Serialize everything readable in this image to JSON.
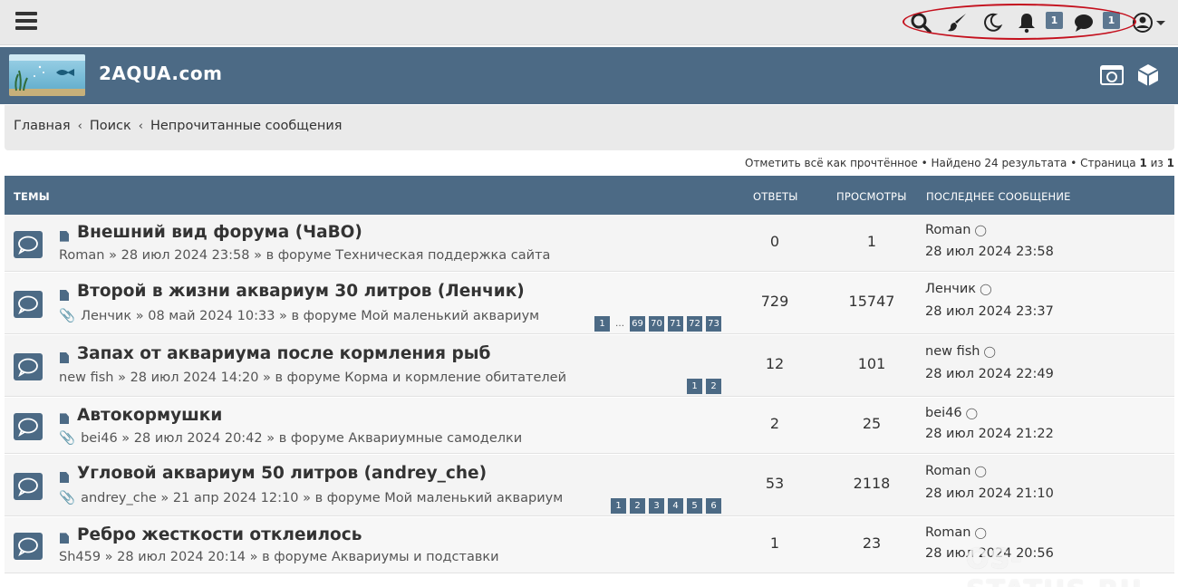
{
  "site": {
    "title": "2AQUA.com"
  },
  "topbar": {
    "notifications_count": "1",
    "messages_count": "1"
  },
  "breadcrumb": {
    "items": [
      "Главная",
      "Поиск",
      "Непрочитанные сообщения"
    ],
    "separator": "‹"
  },
  "actionbar": {
    "mark_read": "Отметить всё как прочтённое",
    "found": "Найдено 24 результата",
    "page_label": "Страница",
    "page_current": "1",
    "of": "из",
    "page_total": "1",
    "bullet": "•"
  },
  "table": {
    "headers": {
      "topics": "Темы",
      "replies": "Ответы",
      "views": "Просмотры",
      "last_post": "Последнее сообщение"
    },
    "rows": [
      {
        "title": "Внешний вид форума (ЧаВО)",
        "author": "Roman",
        "date": "28 июл 2024 23:58",
        "forum_prefix": "в форуме",
        "forum": "Техническая поддержка сайта",
        "replies": "0",
        "views": "1",
        "last_author": "Roman",
        "last_date": "28 июл 2024 23:58",
        "attachment": false,
        "pages": []
      },
      {
        "title": "Второй в жизни аквариум 30 литров (Ленчик)",
        "author": "Ленчик",
        "date": "08 май 2024 10:33",
        "forum_prefix": "в форуме",
        "forum": "Мой маленький аквариум",
        "replies": "729",
        "views": "15747",
        "last_author": "Ленчик",
        "last_date": "28 июл 2024 23:37",
        "attachment": true,
        "pages": [
          "1",
          "…",
          "69",
          "70",
          "71",
          "72",
          "73"
        ]
      },
      {
        "title": "Запах от аквариума после кормления рыб",
        "author": "new fish",
        "date": "28 июл 2024 14:20",
        "forum_prefix": "в форуме",
        "forum": "Корма и кормление обитателей",
        "replies": "12",
        "views": "101",
        "last_author": "new fish",
        "last_date": "28 июл 2024 22:49",
        "attachment": false,
        "pages": [
          "1",
          "2"
        ]
      },
      {
        "title": "Автокормушки",
        "author": "bei46",
        "date": "28 июл 2024 20:42",
        "forum_prefix": "в форуме",
        "forum": "Аквариумные самоделки",
        "replies": "2",
        "views": "25",
        "last_author": "bei46",
        "last_date": "28 июл 2024 21:22",
        "attachment": true,
        "pages": []
      },
      {
        "title": "Угловой аквариум 50 литров (andrey_che)",
        "author": "andrey_che",
        "date": "21 апр 2024 12:10",
        "forum_prefix": "в форуме",
        "forum": "Мой маленький аквариум",
        "replies": "53",
        "views": "2118",
        "last_author": "Roman",
        "last_date": "28 июл 2024 21:10",
        "attachment": true,
        "pages": [
          "1",
          "2",
          "3",
          "4",
          "5",
          "6"
        ]
      },
      {
        "title": "Ребро жесткости отклеилось",
        "author": "Sh459",
        "date": "28 июл 2024 20:14",
        "forum_prefix": "в форуме",
        "forum": "Аквариумы и подставки",
        "replies": "1",
        "views": "23",
        "last_author": "Roman",
        "last_date": "28 июл 2024 20:56",
        "attachment": false,
        "pages": []
      }
    ]
  },
  "watermark": "OS-STATUS.RU",
  "colors": {
    "header": "#4c6a85",
    "topbar": "#e9e9e9",
    "highlight": "#c4101d"
  }
}
